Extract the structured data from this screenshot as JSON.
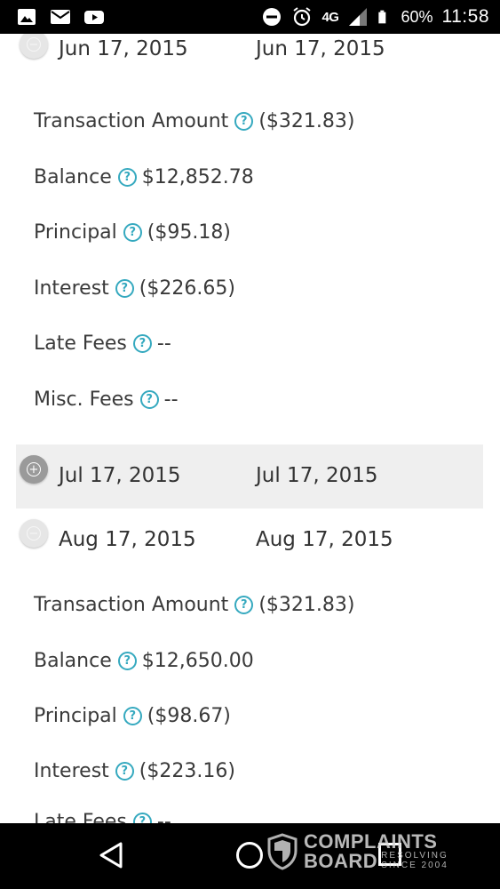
{
  "status_bar": {
    "left_icons": [
      "image-icon",
      "mail-icon",
      "youtube-icon"
    ],
    "right_icons": [
      "do-not-disturb-icon",
      "alarm-icon",
      "signal-icon",
      "battery-icon"
    ],
    "network": "4G",
    "battery": "60%",
    "time": "11:58"
  },
  "transactions": [
    {
      "state": "expanded",
      "date1": "Jun 17, 2015",
      "date2": "Jun 17, 2015",
      "details": [
        {
          "label": "Transaction Amount",
          "value": "($321.83)"
        },
        {
          "label": "Balance",
          "value": "$12,852.78"
        },
        {
          "label": "Principal",
          "value": "($95.18)"
        },
        {
          "label": "Interest",
          "value": "($226.65)"
        },
        {
          "label": "Late Fees",
          "value": "--"
        },
        {
          "label": "Misc. Fees",
          "value": "--"
        }
      ]
    },
    {
      "state": "collapsed",
      "date1": "Jul 17, 2015",
      "date2": "Jul 17, 2015"
    },
    {
      "state": "expanded",
      "date1": "Aug 17, 2015",
      "date2": "Aug 17, 2015",
      "details": [
        {
          "label": "Transaction Amount",
          "value": "($321.83)"
        },
        {
          "label": "Balance",
          "value": "$12,650.00"
        },
        {
          "label": "Principal",
          "value": "($98.67)"
        },
        {
          "label": "Interest",
          "value": "($223.16)"
        },
        {
          "label": "Late Fees",
          "value": "--"
        }
      ]
    }
  ],
  "help_glyph": "?",
  "nav_bar": {
    "icons": [
      "back-icon",
      "home-icon",
      "recents-icon"
    ]
  },
  "watermark": {
    "title_line1": "COMPLAINTS",
    "title_line2": "BOARD",
    "sub_line1": "RESOLVING",
    "sub_line2": "SINCE 2004"
  },
  "colors": {
    "help_accent": "#35a9bf",
    "collapsed_row_bg": "#efefef"
  }
}
